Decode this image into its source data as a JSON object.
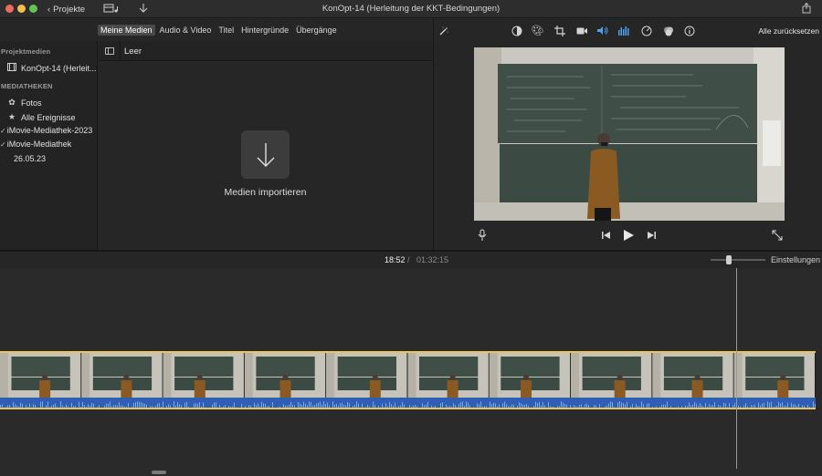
{
  "window": {
    "title": "KonOpt-14 (Herleitung der KKT-Bedingungen)",
    "back_label": "Projekte"
  },
  "browser": {
    "tabs": [
      {
        "label": "Meine Medien",
        "active": true
      },
      {
        "label": "Audio & Video",
        "active": false
      },
      {
        "label": "Titel",
        "active": false
      },
      {
        "label": "Hintergründe",
        "active": false
      },
      {
        "label": "Übergänge",
        "active": false
      }
    ],
    "header_label": "Leer",
    "import_label": "Medien importieren"
  },
  "sidebar": {
    "section_project": "Projektmedien",
    "project_item": "KonOpt-14 (Herleit...",
    "section_libraries": "MEDIATHEKEN",
    "items": [
      {
        "label": "Fotos",
        "icon": "flower-icon"
      },
      {
        "label": "Alle Ereignisse",
        "icon": "star-icon"
      },
      {
        "label": "iMovie-Mediathek-2023",
        "icon": "check-icon"
      },
      {
        "label": "iMovie-Mediathek",
        "icon": "check-icon"
      },
      {
        "label": "26.05.23",
        "icon": ""
      }
    ]
  },
  "viewer": {
    "reset_label": "Alle zurücksetzen",
    "accent_color": "#4ea2f0"
  },
  "timeline": {
    "current_time": "18:52",
    "separator": "/",
    "total_time": "01:32:15",
    "settings_label": "Einstellungen",
    "clip_border_color": "#e8c45a",
    "audio_color": "#2e5fb5",
    "frame_count": 10
  }
}
